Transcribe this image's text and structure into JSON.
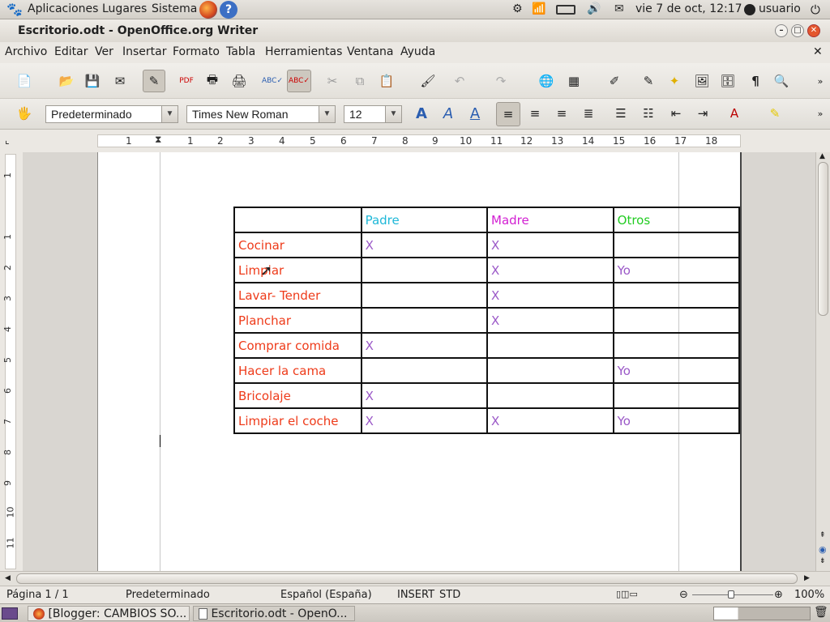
{
  "panel": {
    "apps": "Aplicaciones",
    "places": "Lugares",
    "system": "Sistema",
    "datetime": "vie  7 de oct, 12:17",
    "user": "usuario"
  },
  "window": {
    "title": "Escritorio.odt - OpenOffice.org Writer"
  },
  "menu": [
    "Archivo",
    "Editar",
    "Ver",
    "Insertar",
    "Formato",
    "Tabla",
    "Herramientas",
    "Ventana",
    "Ayuda"
  ],
  "format": {
    "style": "Predeterminado",
    "font": "Times New Roman",
    "size": "12"
  },
  "ruler": [
    "1",
    "1",
    "2",
    "3",
    "4",
    "5",
    "6",
    "7",
    "8",
    "9",
    "10",
    "11",
    "12",
    "13",
    "14",
    "15",
    "16",
    "17",
    "18"
  ],
  "vruler": [
    "1",
    "1",
    "2",
    "3",
    "4",
    "5",
    "6",
    "7",
    "8",
    "9",
    "10",
    "11"
  ],
  "table": {
    "headers": [
      "",
      "Padre",
      "Madre",
      "Otros"
    ],
    "rows": [
      [
        "Cocinar",
        "X",
        "X",
        ""
      ],
      [
        "Limpiar",
        "",
        "X",
        "Yo"
      ],
      [
        "Lavar- Tender",
        "",
        "X",
        ""
      ],
      [
        "Planchar",
        "",
        "X",
        ""
      ],
      [
        "Comprar comida",
        "X",
        "",
        ""
      ],
      [
        "Hacer la cama",
        "",
        "",
        "Yo"
      ],
      [
        "Bricolaje",
        "X",
        "",
        ""
      ],
      [
        "Limpiar el coche",
        "X",
        "X",
        "Yo"
      ]
    ]
  },
  "colors": {
    "padre": "#1fb8d8",
    "madre": "#d21fd2",
    "otros": "#22cc22",
    "task": "#ee3b1a",
    "mark": "#9b59c8"
  },
  "statusbar": {
    "page": "Página  1 / 1",
    "style": "Predeterminado",
    "language": "Español (España)",
    "mode": "INSERT",
    "sel": "STD",
    "zoom": "100%"
  },
  "taskbar": {
    "task1": "[Blogger: CAMBIOS SO...",
    "task2": "Escritorio.odt - OpenO..."
  }
}
